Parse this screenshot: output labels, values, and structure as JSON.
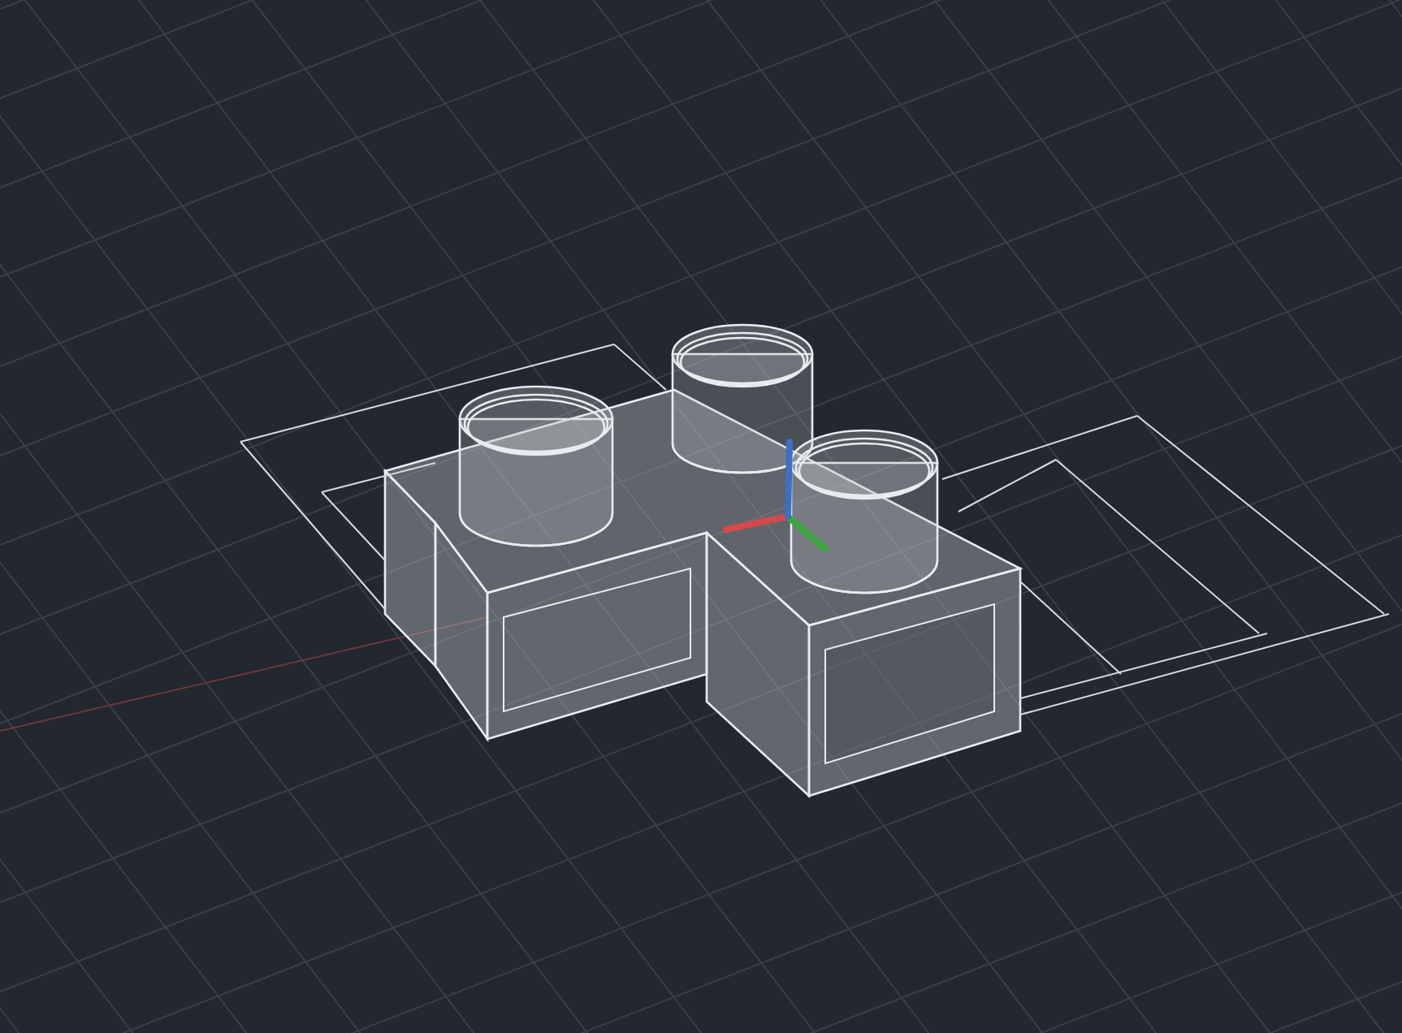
{
  "viewport": {
    "show_grid": true,
    "show_dimensions": true,
    "show_ucs_icon": true
  }
}
